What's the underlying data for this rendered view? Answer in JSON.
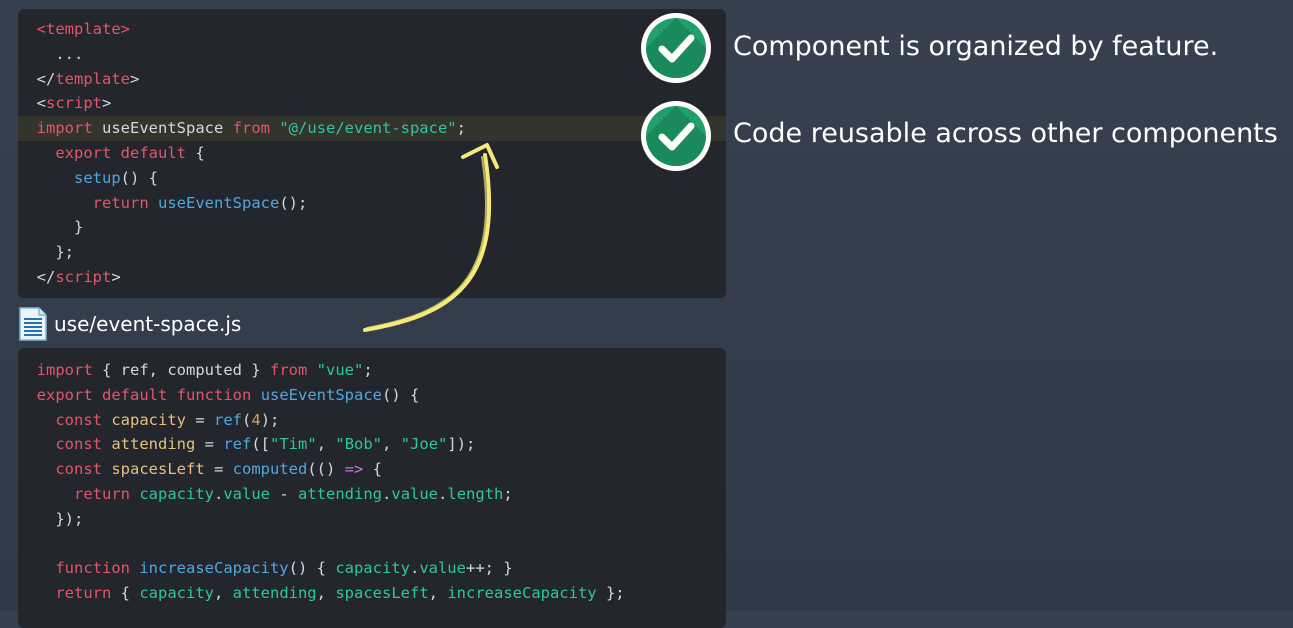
{
  "features": [
    {
      "text": "Component is organized by feature."
    },
    {
      "text": "Code reusable across other components"
    }
  ],
  "file_label": "use/event-space.js",
  "colors": {
    "background": "#333c4b",
    "panel": "#23262c",
    "check_green": "#22a06b",
    "arrow": "#f5e97a",
    "keyword": "#e2566b",
    "string": "#2dc5a3",
    "function": "#4ea9e0",
    "variable": "#e7c07b"
  },
  "icons": {
    "check": "check-circle-icon",
    "file": "document-icon",
    "arrow": "curved-arrow-icon"
  },
  "code_top": [
    [
      [
        "t-plain",
        "  "
      ],
      [
        "t-tag",
        "<template>"
      ]
    ],
    [
      [
        "t-plain",
        "    ..."
      ]
    ],
    [
      [
        "t-plain",
        "  </"
      ],
      [
        "t-tag",
        "template"
      ],
      [
        "t-plain",
        ">"
      ]
    ],
    [
      [
        "t-plain",
        "  <"
      ],
      [
        "t-tag",
        "script"
      ],
      [
        "t-plain",
        ">"
      ]
    ],
    [
      [
        "t-plain",
        "  "
      ],
      [
        "t-kw",
        "import"
      ],
      [
        "t-plain",
        " useEventSpace "
      ],
      [
        "t-kw",
        "from"
      ],
      [
        "t-plain",
        " "
      ],
      [
        "t-str",
        "\"@/use/event-space\""
      ],
      [
        "t-plain",
        ";"
      ]
    ],
    [
      [
        "t-plain",
        "    "
      ],
      [
        "t-kw",
        "export"
      ],
      [
        "t-plain",
        " "
      ],
      [
        "t-kw",
        "default"
      ],
      [
        "t-plain",
        " {"
      ]
    ],
    [
      [
        "t-plain",
        "      "
      ],
      [
        "t-fn",
        "setup"
      ],
      [
        "t-plain",
        "() {"
      ]
    ],
    [
      [
        "t-plain",
        "        "
      ],
      [
        "t-kw",
        "return"
      ],
      [
        "t-plain",
        " "
      ],
      [
        "t-fn",
        "useEventSpace"
      ],
      [
        "t-plain",
        "();"
      ]
    ],
    [
      [
        "t-plain",
        "      }"
      ]
    ],
    [
      [
        "t-plain",
        "    };"
      ]
    ],
    [
      [
        "t-plain",
        "  </"
      ],
      [
        "t-tag",
        "script"
      ],
      [
        "t-plain",
        ">"
      ]
    ]
  ],
  "code_bottom": [
    [
      [
        "t-plain",
        "  "
      ],
      [
        "t-kw",
        "import"
      ],
      [
        "t-plain",
        " { ref, computed } "
      ],
      [
        "t-kw",
        "from"
      ],
      [
        "t-plain",
        " "
      ],
      [
        "t-str",
        "\"vue\""
      ],
      [
        "t-plain",
        ";"
      ]
    ],
    [
      [
        "t-plain",
        "  "
      ],
      [
        "t-kw",
        "export"
      ],
      [
        "t-plain",
        " "
      ],
      [
        "t-kw",
        "default"
      ],
      [
        "t-plain",
        " "
      ],
      [
        "t-kw",
        "function"
      ],
      [
        "t-plain",
        " "
      ],
      [
        "t-fn",
        "useEventSpace"
      ],
      [
        "t-plain",
        "() {"
      ]
    ],
    [
      [
        "t-plain",
        "    "
      ],
      [
        "t-kw",
        "const"
      ],
      [
        "t-plain",
        " "
      ],
      [
        "t-var",
        "capacity"
      ],
      [
        "t-plain",
        " = "
      ],
      [
        "t-fn",
        "ref"
      ],
      [
        "t-plain",
        "("
      ],
      [
        "t-num",
        "4"
      ],
      [
        "t-plain",
        ");"
      ]
    ],
    [
      [
        "t-plain",
        "    "
      ],
      [
        "t-kw",
        "const"
      ],
      [
        "t-plain",
        " "
      ],
      [
        "t-var",
        "attending"
      ],
      [
        "t-plain",
        " = "
      ],
      [
        "t-fn",
        "ref"
      ],
      [
        "t-plain",
        "(["
      ],
      [
        "t-str",
        "\"Tim\""
      ],
      [
        "t-plain",
        ", "
      ],
      [
        "t-str",
        "\"Bob\""
      ],
      [
        "t-plain",
        ", "
      ],
      [
        "t-str",
        "\"Joe\""
      ],
      [
        "t-plain",
        "]);"
      ]
    ],
    [
      [
        "t-plain",
        "    "
      ],
      [
        "t-kw",
        "const"
      ],
      [
        "t-plain",
        " "
      ],
      [
        "t-var",
        "spacesLeft"
      ],
      [
        "t-plain",
        " = "
      ],
      [
        "t-fn",
        "computed"
      ],
      [
        "t-plain",
        "(() "
      ],
      [
        "t-op",
        "=>"
      ],
      [
        "t-plain",
        " {"
      ]
    ],
    [
      [
        "t-plain",
        "      "
      ],
      [
        "t-kw",
        "return"
      ],
      [
        "t-plain",
        " "
      ],
      [
        "t-prop",
        "capacity"
      ],
      [
        "t-plain",
        "."
      ],
      [
        "t-prop",
        "value"
      ],
      [
        "t-plain",
        " - "
      ],
      [
        "t-prop",
        "attending"
      ],
      [
        "t-plain",
        "."
      ],
      [
        "t-prop",
        "value"
      ],
      [
        "t-plain",
        "."
      ],
      [
        "t-prop",
        "length"
      ],
      [
        "t-plain",
        ";"
      ]
    ],
    [
      [
        "t-plain",
        "    });"
      ]
    ],
    [
      [
        "t-plain",
        ""
      ]
    ],
    [
      [
        "t-plain",
        "    "
      ],
      [
        "t-kw",
        "function"
      ],
      [
        "t-plain",
        " "
      ],
      [
        "t-fn",
        "increaseCapacity"
      ],
      [
        "t-plain",
        "() { "
      ],
      [
        "t-prop",
        "capacity"
      ],
      [
        "t-plain",
        "."
      ],
      [
        "t-prop",
        "value"
      ],
      [
        "t-plain",
        "++; }"
      ]
    ],
    [
      [
        "t-plain",
        "    "
      ],
      [
        "t-kw",
        "return"
      ],
      [
        "t-plain",
        " { "
      ],
      [
        "t-prop",
        "capacity"
      ],
      [
        "t-plain",
        ", "
      ],
      [
        "t-prop",
        "attending"
      ],
      [
        "t-plain",
        ", "
      ],
      [
        "t-prop",
        "spacesLeft"
      ],
      [
        "t-plain",
        ", "
      ],
      [
        "t-prop",
        "increaseCapacity"
      ],
      [
        "t-plain",
        " };"
      ]
    ]
  ]
}
